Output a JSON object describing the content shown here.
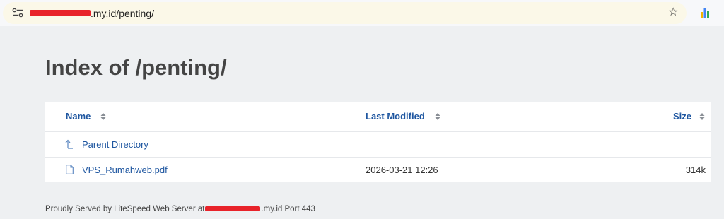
{
  "browser": {
    "url_suffix": ".my.id/penting/",
    "site_info_icon": "tune-icon",
    "bookmark_icon": "star-icon",
    "extension_icon": "bar-chart-icon"
  },
  "page": {
    "title": "Index of /penting/"
  },
  "listing": {
    "columns": {
      "name": "Name",
      "modified": "Last Modified",
      "size": "Size"
    },
    "sort_icon": "sort-arrows-icon",
    "rows": [
      {
        "name": "Parent Directory",
        "modified": "",
        "size": "",
        "icon": "up-arrow-icon"
      },
      {
        "name": "VPS_Rumahweb.pdf",
        "modified": "2026-03-21 12:26",
        "size": "314k",
        "icon": "file-icon"
      }
    ]
  },
  "footer": {
    "prefix": "Proudly Served by LiteSpeed Web Server at",
    "host_suffix": ".my.id Port 443"
  },
  "colors": {
    "link": "#1e56a0",
    "background": "#eef0f2",
    "redaction": "#e8232a"
  }
}
